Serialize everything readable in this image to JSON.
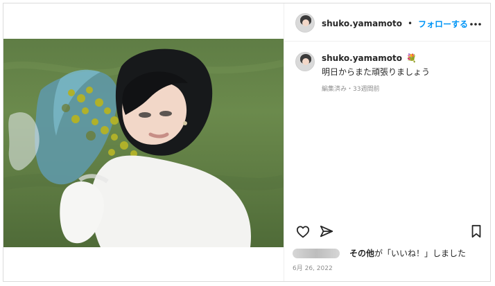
{
  "post": {
    "username": "shuko.yamamoto",
    "follow_label": "フォローする",
    "dot": "•",
    "caption": {
      "username": "shuko.yamamoto",
      "emoji": "💐",
      "text": "明日からまた頑張りましょう",
      "meta": "編集済み・33週間前"
    },
    "likes": {
      "text_bold": "その他",
      "text_rest": "が「いいね！」しました"
    },
    "date": "6月 26, 2022"
  },
  "icons": {
    "more": "more-options-icon",
    "like": "heart-icon",
    "share": "share-plane-icon",
    "save": "bookmark-icon"
  }
}
